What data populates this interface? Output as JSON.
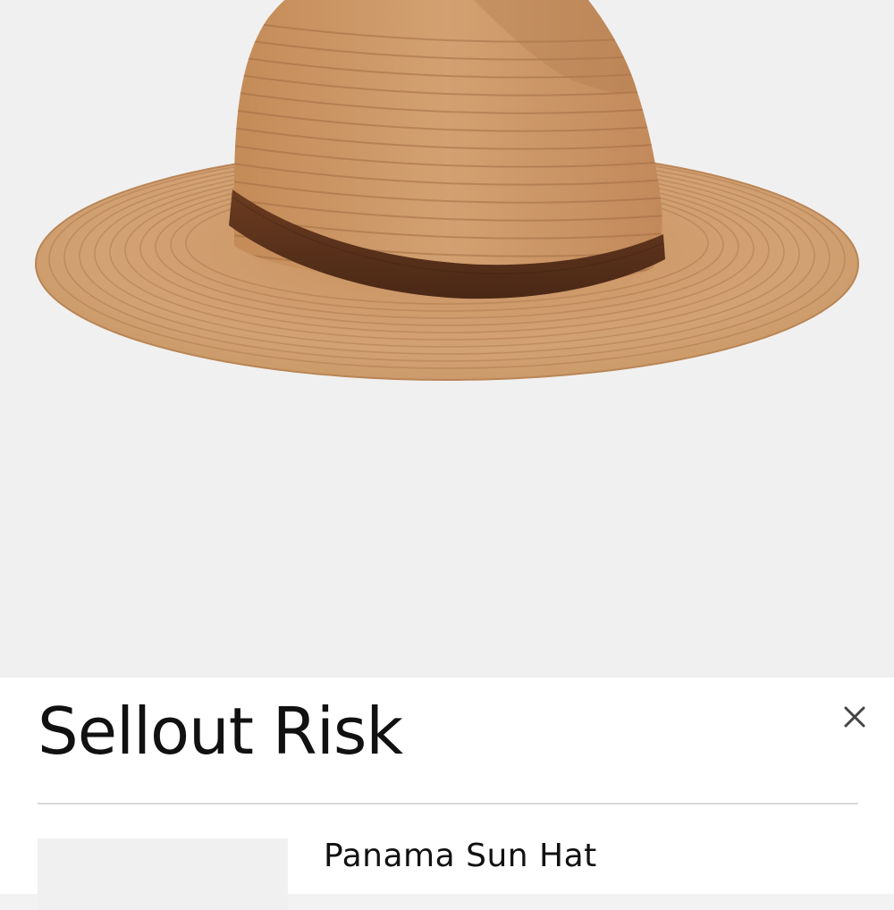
{
  "colors": {
    "hero_background": "#f1f0f0",
    "sheet_background": "#ffffff",
    "text": "#111111",
    "divider": "#d9d9d9",
    "straw": "#cc9a6c",
    "hat_band": "#5a321c"
  },
  "hero": {
    "image": "straw-panama-hat-with-brown-leather-band"
  },
  "sheet": {
    "title": "Sellout Risk",
    "close_icon": "close-icon"
  },
  "product": {
    "name": "Panama Sun Hat",
    "thumbnail": "product-thumbnail"
  }
}
